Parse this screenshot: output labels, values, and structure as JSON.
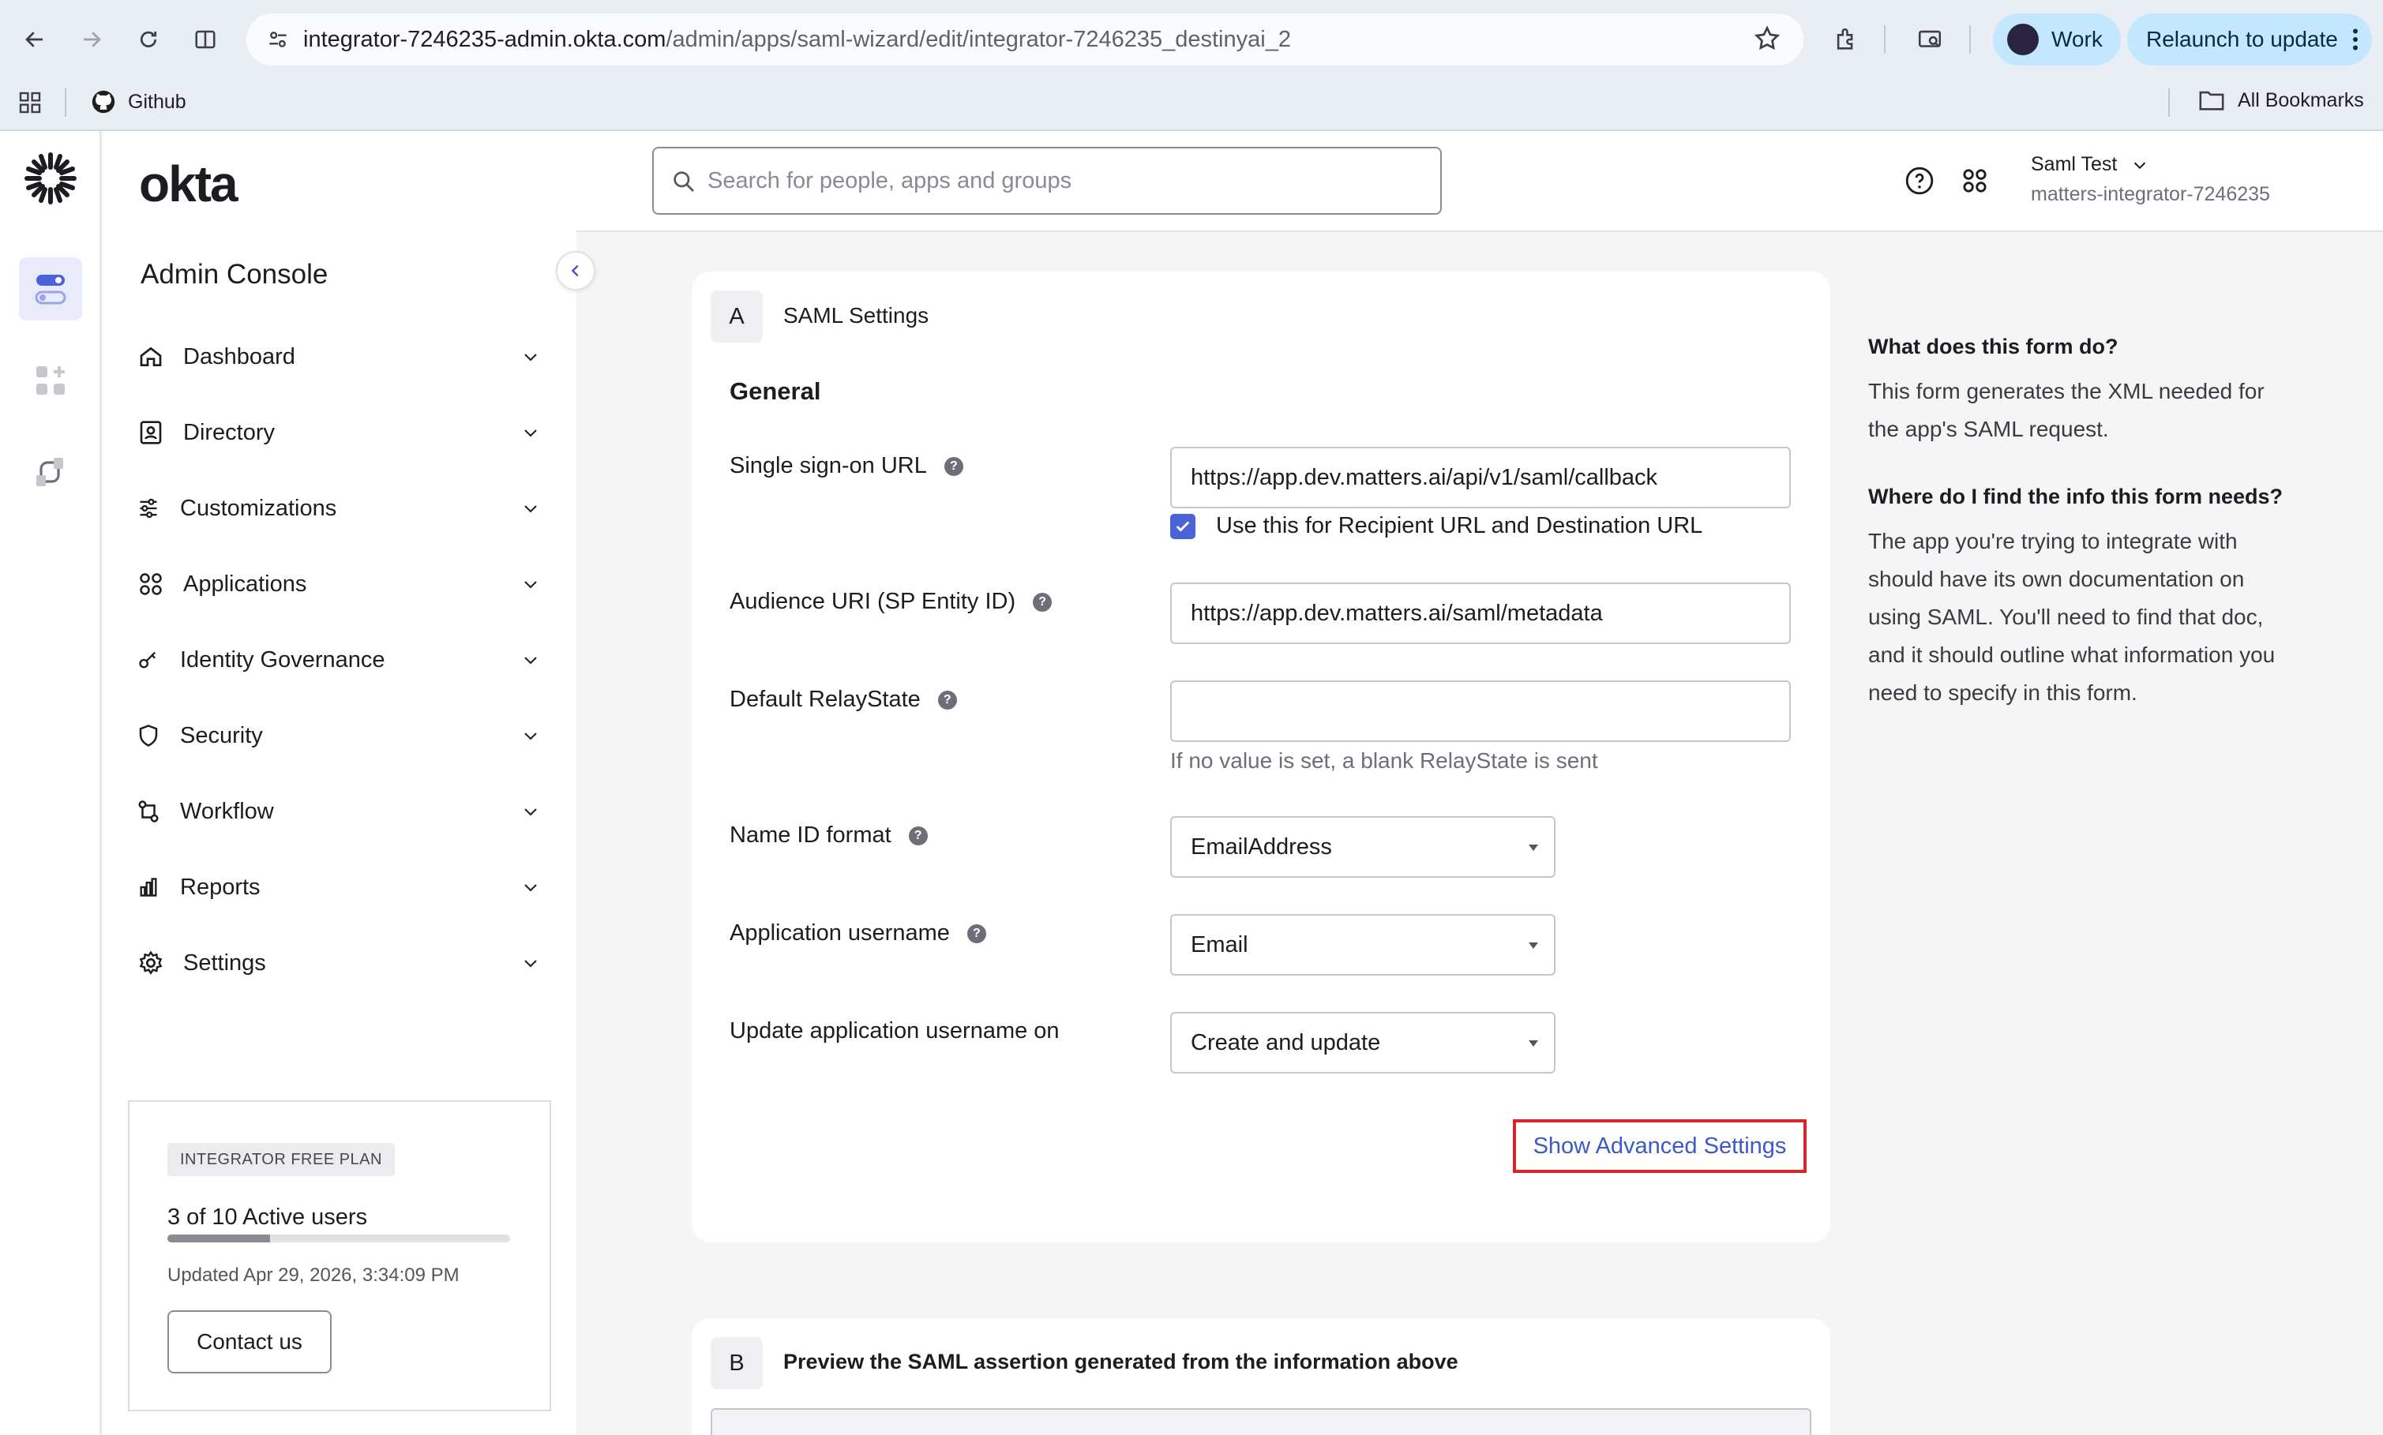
{
  "browser": {
    "url_host": "integrator-7246235-admin.okta.com",
    "url_path": "/admin/apps/saml-wizard/edit/integrator-7246235_destinyai_2",
    "profile_label": "Work",
    "relaunch_label": "Relaunch to update",
    "bookmark_github": "Github",
    "all_bookmarks": "All Bookmarks"
  },
  "brand": {
    "logo_text": "okta",
    "console_title": "Admin Console"
  },
  "sidebar": {
    "items": [
      {
        "label": "Dashboard",
        "icon": "home-icon"
      },
      {
        "label": "Directory",
        "icon": "directory-icon"
      },
      {
        "label": "Customizations",
        "icon": "sliders-icon"
      },
      {
        "label": "Applications",
        "icon": "apps-grid-icon"
      },
      {
        "label": "Identity Governance",
        "icon": "key-icon"
      },
      {
        "label": "Security",
        "icon": "shield-icon"
      },
      {
        "label": "Workflow",
        "icon": "workflow-icon"
      },
      {
        "label": "Reports",
        "icon": "reports-icon"
      },
      {
        "label": "Settings",
        "icon": "gear-icon"
      }
    ],
    "plan": {
      "badge": "INTEGRATOR FREE PLAN",
      "users_text": "3 of 10 Active users",
      "users_fraction": 0.3,
      "updated": "Updated Apr 29, 2026, 3:34:09 PM",
      "contact_label": "Contact us"
    }
  },
  "header": {
    "search_placeholder": "Search for people, apps and groups",
    "user_name": "Saml Test",
    "org_name": "matters-integrator-7246235"
  },
  "section_a": {
    "step": "A",
    "title": "SAML Settings",
    "group_title": "General",
    "fields": {
      "sso_url_label": "Single sign-on URL",
      "sso_url_value": "https://app.dev.matters.ai/api/v1/saml/callback",
      "recipient_checkbox_label": "Use this for Recipient URL and Destination URL",
      "recipient_checked": true,
      "audience_label": "Audience URI (SP Entity ID)",
      "audience_value": "https://app.dev.matters.ai/saml/metadata",
      "relaystate_label": "Default RelayState",
      "relaystate_value": "",
      "relaystate_hint": "If no value is set, a blank RelayState is sent",
      "nameid_label": "Name ID format",
      "nameid_value": "EmailAddress",
      "app_username_label": "Application username",
      "app_username_value": "Email",
      "update_on_label": "Update application username on",
      "update_on_value": "Create and update"
    },
    "advanced_link": "Show Advanced Settings"
  },
  "section_b": {
    "step": "B",
    "title": "Preview the SAML assertion generated from the information above"
  },
  "help": {
    "q1": "What does this form do?",
    "a1": "This form generates the XML needed for the app's SAML request.",
    "q2": "Where do I find the info this form needs?",
    "a2": "The app you're trying to integrate with should have its own documentation on using SAML. You'll need to find that doc, and it should outline what information you need to specify in this form."
  },
  "colors": {
    "accent": "#3d58c8",
    "highlight_border": "#d6262a",
    "chrome_pill": "#c2e7ff",
    "checkbox": "#4c62d8"
  }
}
